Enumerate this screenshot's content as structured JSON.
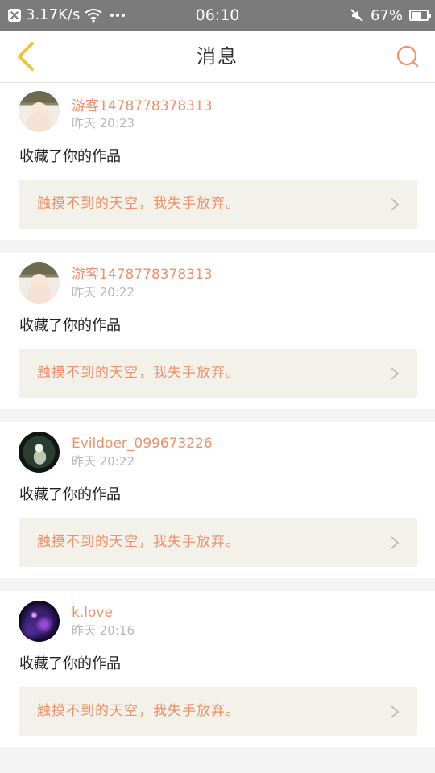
{
  "status_bar": {
    "network_speed": "3.17K/s",
    "time": "06:10",
    "battery": "67%",
    "battery_level": 0.67,
    "icons": [
      "close-icon",
      "wifi-icon",
      "more-dots-icon",
      "mute-icon",
      "battery-icon"
    ]
  },
  "header": {
    "title": "消息",
    "back_icon": "chevron-left-icon",
    "search_icon": "search-icon"
  },
  "colors": {
    "accent": "#f0916a",
    "back_arrow": "#f2c530",
    "status_bar_bg": "#7b7b7b",
    "quote_bg": "#f2f2ea"
  },
  "messages": [
    {
      "username": "游客1478778378313",
      "time": "昨天 20:23",
      "action": "收藏了你的作品",
      "quote": "触摸不到的天空，我失手放弃。",
      "avatar": "avatar-boy"
    },
    {
      "username": "游客1478778378313",
      "time": "昨天 20:22",
      "action": "收藏了你的作品",
      "quote": "触摸不到的天空，我失手放弃。",
      "avatar": "avatar-boy"
    },
    {
      "username": "Evildoer_099673226",
      "time": "昨天 20:22",
      "action": "收藏了你的作品",
      "quote": "触摸不到的天空，我失手放弃。",
      "avatar": "avatar-girl"
    },
    {
      "username": "k.love",
      "time": "昨天 20:16",
      "action": "收藏了你的作品",
      "quote": "触摸不到的天空，我失手放弃。",
      "avatar": "avatar-space"
    }
  ]
}
